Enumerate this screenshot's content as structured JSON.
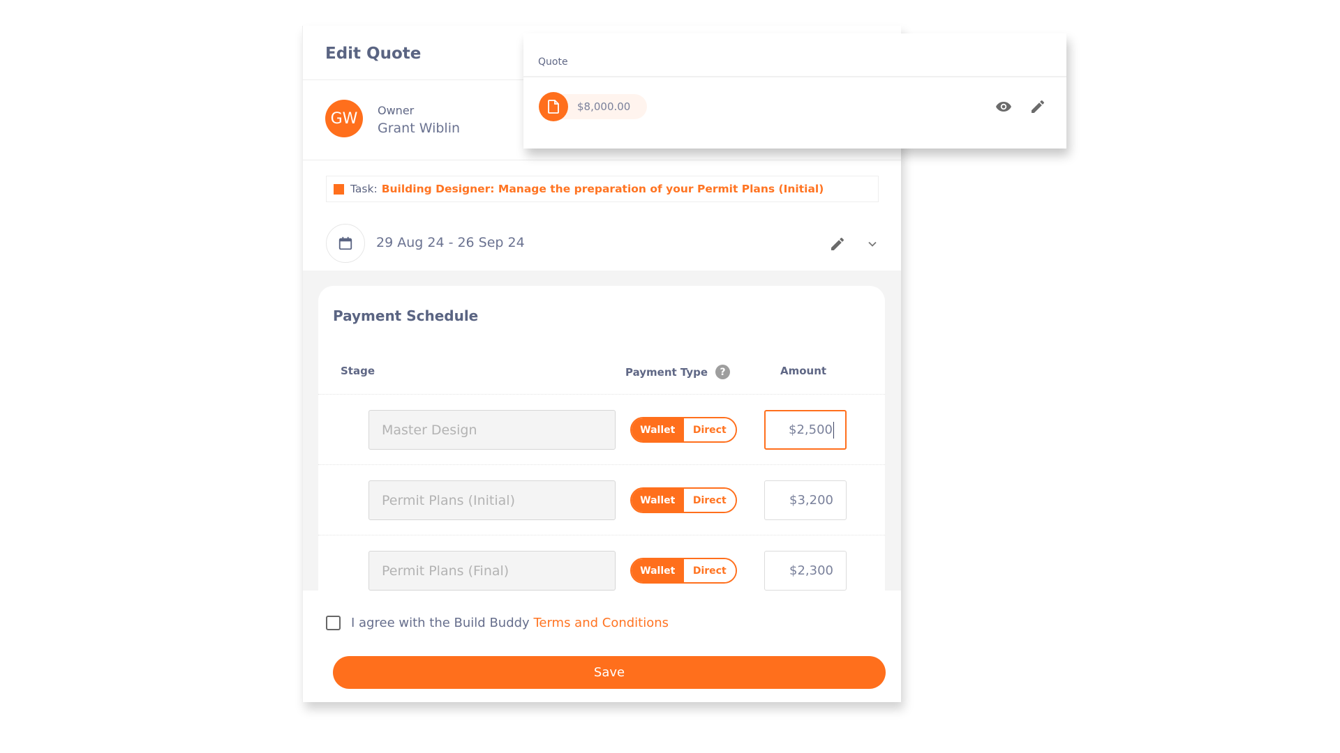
{
  "panel": {
    "title": "Edit Quote",
    "owner": {
      "initials": "GW",
      "label": "Owner",
      "name": "Grant Wiblin"
    },
    "task": {
      "prefix": "Task:",
      "title": "Building Designer: Manage the preparation of your Permit Plans (Initial)"
    },
    "dates": {
      "range": "29 Aug 24 - 26 Sep 24",
      "icons": [
        "calendar-icon",
        "pencil-icon",
        "chevron-down-icon"
      ]
    }
  },
  "payment_schedule": {
    "title": "Payment Schedule",
    "columns": {
      "stage": "Stage",
      "payment_type": "Payment Type",
      "help": "?",
      "amount": "Amount"
    },
    "rows": [
      {
        "stage": "Master Design",
        "wallet_label": "Wallet",
        "direct_label": "Direct",
        "selected": "Wallet",
        "amount": "$2,500",
        "focused": true
      },
      {
        "stage": "Permit Plans (Initial)",
        "wallet_label": "Wallet",
        "direct_label": "Direct",
        "selected": "Wallet",
        "amount": "$3,200",
        "focused": false
      },
      {
        "stage": "Permit Plans (Final)",
        "wallet_label": "Wallet",
        "direct_label": "Direct",
        "selected": "Wallet",
        "amount": "$2,300",
        "focused": false
      }
    ]
  },
  "footer": {
    "agree_text": "I agree with the Build Buddy",
    "terms_link": "Terms and Conditions",
    "agree_checked": false,
    "save_label": "Save"
  },
  "quote_popup": {
    "title": "Quote",
    "amount": "$8,000.00",
    "icons": [
      "file-icon",
      "eye-icon",
      "pencil-icon"
    ]
  },
  "colors": {
    "accent": "#ff6f1c",
    "text": "#5c6481",
    "muted_text": "#b3b3b3",
    "panel_bg": "#f4f4f4"
  }
}
